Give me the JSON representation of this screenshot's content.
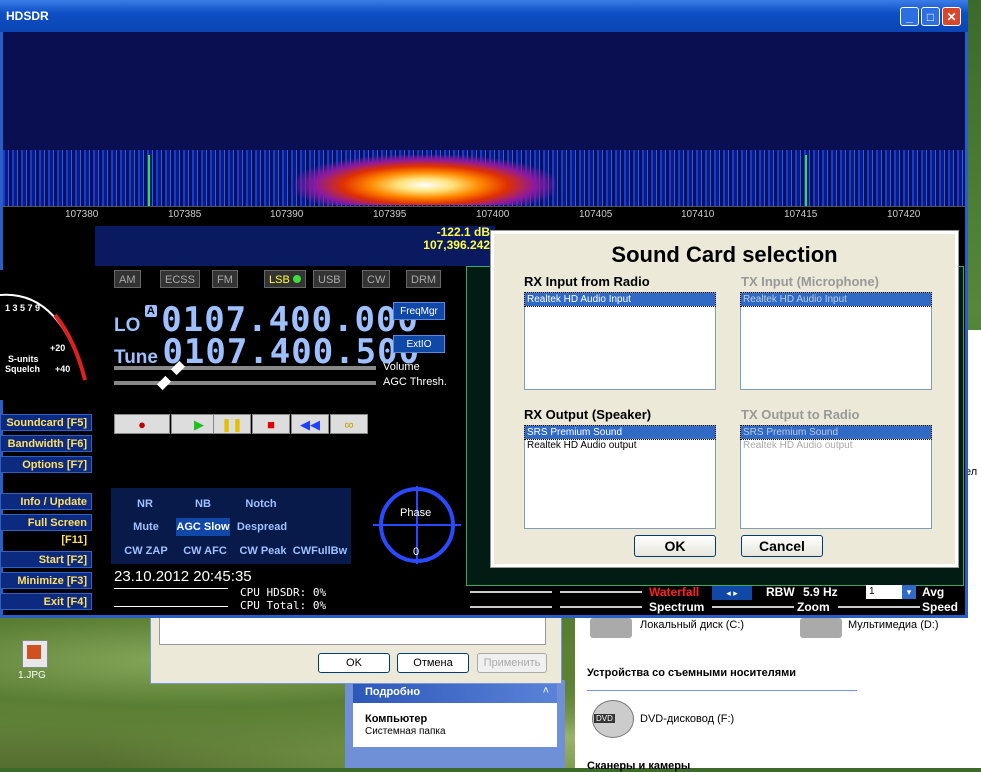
{
  "window": {
    "title": "HDSDR"
  },
  "waterfall": {
    "ticks": [
      "107380",
      "107385",
      "107390",
      "107395",
      "107400",
      "107405",
      "107410",
      "107415",
      "107420"
    ]
  },
  "readout": {
    "level": "-122.1 dB",
    "freq": "107,396.242"
  },
  "modes": [
    "AM",
    "ECSS",
    "FM",
    "LSB",
    "USB",
    "CW",
    "DRM"
  ],
  "active_mode": "LSB",
  "lo": {
    "label": "LO",
    "badge": "A",
    "value": "0107.400.000"
  },
  "tune": {
    "label": "Tune",
    "value": "0107.400.500"
  },
  "right_buttons": {
    "freqmgr": "FreqMgr",
    "extio": "ExtIO",
    "volume": "Volume",
    "agc": "AGC Thresh."
  },
  "smeter": {
    "s_units": "S-units",
    "squelch": "Squelch",
    "p20": "+20",
    "p40": "+40",
    "scale": "1 3 5 7 9"
  },
  "side_buttons": {
    "soundcard": "Soundcard  [F5]",
    "bandwidth": "Bandwidth  [F6]",
    "options": "Options   [F7]",
    "info": "Info / Update  [F9]",
    "fullscreen": "Full Screen  [F11]",
    "start": "Start     [F2]",
    "minimize": "Minimize  [F3]",
    "exit": "Exit     [F4]"
  },
  "dsp": {
    "nr": "NR",
    "nb": "NB",
    "notch": "Notch",
    "mute": "Mute",
    "agc_slow": "AGC Slow",
    "despread": "Despread",
    "cwzap": "CW ZAP",
    "cwafc": "CW AFC",
    "cwpeak": "CW Peak",
    "cwfullbw": "CWFullBw"
  },
  "phase": {
    "label": "Phase",
    "zero": "0"
  },
  "datetime": "23.10.2012 20:45:35",
  "cpu": {
    "hdsdr": "CPU HDSDR:  0%",
    "total": "CPU Total:  0%"
  },
  "bottom": {
    "waterfall": "Waterfall",
    "spectrum": "Spectrum",
    "rbw_label": "RBW",
    "rbw_value": "5.9 Hz",
    "zoom": "Zoom",
    "avg_value": "1",
    "avg": "Avg",
    "speed": "Speed"
  },
  "dialog": {
    "title": "Sound Card selection",
    "rx_in_label": "RX Input from Radio",
    "tx_in_label": "TX Input (Microphone)",
    "rx_out_label": "RX Output (Speaker)",
    "tx_out_label": "TX Output to Radio",
    "rx_in_items": [
      "Realtek HD Audio Input"
    ],
    "tx_in_items": [
      "Realtek HD Audio Input"
    ],
    "rx_out_items": [
      "SRS Premium Sound",
      "Realtek HD Audio output"
    ],
    "tx_out_items": [
      "SRS Premium Sound",
      "Realtek HD Audio output"
    ],
    "ok": "OK",
    "cancel": "Cancel"
  },
  "behind_dialog": {
    "ok": "OK",
    "cancel": "Отмена",
    "apply": "Применить"
  },
  "explorer": {
    "local_disk": "Локальный диск (C:)",
    "media": "Мультимедиа (D:)",
    "removable_header": "Устройства со съемными носителями",
    "dvd": "DVD-дисковод (F:)",
    "scanners": "Сканеры и камеры",
    "details": "Подробно",
    "computer": "Компьютер",
    "system_folder": "Системная папка",
    "side_e": "е",
    "side_el": "ел"
  },
  "desktop_icon": {
    "label": "1.JPG"
  }
}
